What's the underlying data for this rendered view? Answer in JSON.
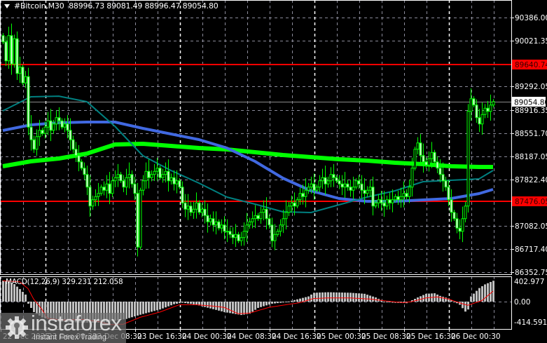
{
  "header": {
    "symbol": "#Bitcoin,M30",
    "ohlc": "88996.73 89081.49 88996.47 89054.80"
  },
  "colors": {
    "background": "#000000",
    "candle": "#00ff00",
    "bear_fill": "#d8ffd8",
    "ma_slow": "#00ff00",
    "ma_mid": "#4169e1",
    "ma_fast": "#008080",
    "level_line": "#ff0000",
    "macd_hist": "#c0c0c0",
    "macd_signal": "#ff0000",
    "grid": "#8a8a99"
  },
  "chart_data": [
    {
      "type": "candlestick",
      "title": "#Bitcoin,M30",
      "timeframe": "M30",
      "ylim": [
        86352.75,
        90386.0
      ],
      "y_ticks": [
        "90386.00",
        "90021.35",
        "89292.05",
        "88916.35",
        "88551.70",
        "88187.05",
        "87822.40",
        "87082.05",
        "86717.40",
        "86352.75"
      ],
      "x_ticks": [
        "22 Dec 2025",
        "23 Dec 00:30",
        "23 Dec 08:30",
        "23 Dec 16:30",
        "24 Dec 00:30",
        "24 Dec 08:30",
        "24 Dec 16:30",
        "25 Dec 00:30",
        "25 Dec 08:30",
        "25 Dec 16:30",
        "26 Dec 00:30"
      ],
      "bars_per_tick": 16,
      "grid": true,
      "current_price": "89054.80",
      "levels": [
        {
          "name": "resistance",
          "value": "89640.74"
        },
        {
          "name": "support",
          "value": "87476.05"
        }
      ],
      "closes": [
        90000,
        89700,
        90100,
        89650,
        90050,
        89500,
        89600,
        89350,
        89450,
        88650,
        88450,
        88300,
        88500,
        88600,
        88550,
        88650,
        88750,
        88600,
        88700,
        88800,
        88750,
        88650,
        88700,
        88600,
        88450,
        88300,
        88200,
        88100,
        88000,
        87900,
        87700,
        87400,
        87500,
        87550,
        87600,
        87700,
        87650,
        87750,
        87600,
        87800,
        87850,
        87900,
        87800,
        87700,
        87850,
        87900,
        87750,
        87600,
        86750,
        87650,
        87800,
        87950,
        87850,
        87900,
        87950,
        88000,
        87850,
        87900,
        87950,
        87800,
        87850,
        87750,
        87800,
        87700,
        87450,
        87350,
        87400,
        87300,
        87350,
        87450,
        87300,
        87350,
        87250,
        87150,
        87200,
        87100,
        87150,
        87050,
        87100,
        87000,
        87000,
        86950,
        86900,
        86950,
        86850,
        86900,
        87000,
        87100,
        87150,
        87200,
        87250,
        87200,
        87300,
        87350,
        87200,
        87100,
        86850,
        86950,
        87000,
        87100,
        87200,
        87300,
        87400,
        87450,
        87400,
        87500,
        87600,
        87550,
        87650,
        87700,
        87750,
        87650,
        87700,
        87800,
        87850,
        87750,
        87800,
        87900,
        87850,
        87800,
        87750,
        87700,
        87750,
        87700,
        87650,
        87700,
        87800,
        87750,
        87650,
        87600,
        87650,
        87700,
        87400,
        87450,
        87500,
        87450,
        87400,
        87500,
        87450,
        87500,
        87550,
        87500,
        87550,
        87600,
        87550,
        87700,
        88000,
        88300,
        88400,
        88200,
        88100,
        88050,
        88150,
        88250,
        88100,
        88000,
        87900,
        87800,
        87700,
        87500,
        87300,
        87200,
        87050,
        87000,
        87200,
        87400,
        88900,
        89100,
        89000,
        88800,
        88700,
        88850,
        88950,
        88900,
        89000,
        89054.8
      ],
      "moving_averages": [
        {
          "name": "MA slow",
          "color_key": "ma_slow",
          "points": [
            [
              0,
              88030
            ],
            [
              10,
              88108
            ],
            [
              20,
              88153
            ],
            [
              30,
              88230
            ],
            [
              40,
              88375
            ],
            [
              50,
              88386
            ],
            [
              60,
              88353
            ],
            [
              70,
              88319
            ],
            [
              80,
              88297
            ],
            [
              90,
              88253
            ],
            [
              100,
              88208
            ],
            [
              110,
              88175
            ],
            [
              120,
              88142
            ],
            [
              130,
              88119
            ],
            [
              140,
              88086
            ],
            [
              150,
              88064
            ],
            [
              160,
              88030
            ],
            [
              170,
              88019
            ],
            [
              175,
              88019
            ]
          ]
        },
        {
          "name": "MA mid",
          "color_key": "ma_mid",
          "points": [
            [
              0,
              88597
            ],
            [
              10,
              88686
            ],
            [
              20,
              88719
            ],
            [
              30,
              88730
            ],
            [
              40,
              88730
            ],
            [
              50,
              88630
            ],
            [
              60,
              88542
            ],
            [
              70,
              88453
            ],
            [
              80,
              88319
            ],
            [
              90,
              88108
            ],
            [
              100,
              87842
            ],
            [
              110,
              87642
            ],
            [
              120,
              87519
            ],
            [
              130,
              87475
            ],
            [
              140,
              87475
            ],
            [
              150,
              87497
            ],
            [
              160,
              87519
            ],
            [
              170,
              87597
            ],
            [
              175,
              87664
            ]
          ]
        },
        {
          "name": "MA fast",
          "color_key": "ma_fast",
          "points": [
            [
              0,
              88908
            ],
            [
              10,
              89130
            ],
            [
              20,
              89141
            ],
            [
              30,
              89053
            ],
            [
              40,
              88664
            ],
            [
              50,
              88197
            ],
            [
              60,
              87964
            ],
            [
              70,
              87764
            ],
            [
              80,
              87542
            ],
            [
              90,
              87430
            ],
            [
              100,
              87308
            ],
            [
              110,
              87297
            ],
            [
              120,
              87419
            ],
            [
              130,
              87542
            ],
            [
              140,
              87642
            ],
            [
              150,
              87786
            ],
            [
              160,
              87808
            ],
            [
              170,
              87830
            ],
            [
              175,
              87964
            ]
          ]
        }
      ]
    },
    {
      "type": "bar+line",
      "title": "MACD(12,26,9)",
      "macd_value": "329.231",
      "signal_value": "212.058",
      "ylim": [
        -414.591,
        402.977
      ],
      "y_ticks": [
        "402.977",
        "0.00",
        "-414.591"
      ],
      "histogram_points": [
        [
          0,
          400
        ],
        [
          2,
          380
        ],
        [
          4,
          335
        ],
        [
          6,
          240
        ],
        [
          8,
          135
        ],
        [
          9,
          -40
        ],
        [
          11,
          -200
        ],
        [
          14,
          -300
        ],
        [
          19,
          -380
        ],
        [
          29,
          -400
        ],
        [
          36,
          -400
        ],
        [
          44,
          -330
        ],
        [
          49,
          -250
        ],
        [
          56,
          -150
        ],
        [
          61,
          -50
        ],
        [
          64,
          -20
        ],
        [
          69,
          -60
        ],
        [
          79,
          -200
        ],
        [
          85,
          -255
        ],
        [
          88,
          -230
        ],
        [
          91,
          -120
        ],
        [
          96,
          -40
        ],
        [
          101,
          -10
        ],
        [
          104,
          30
        ],
        [
          109,
          100
        ],
        [
          111,
          170
        ],
        [
          116,
          180
        ],
        [
          124,
          170
        ],
        [
          129,
          150
        ],
        [
          133,
          80
        ],
        [
          136,
          0
        ],
        [
          139,
          -20
        ],
        [
          144,
          -30
        ],
        [
          145,
          0
        ],
        [
          148,
          80
        ],
        [
          151,
          150
        ],
        [
          154,
          160
        ],
        [
          156,
          110
        ],
        [
          159,
          60
        ],
        [
          161,
          0
        ],
        [
          163,
          -60
        ],
        [
          165,
          -190
        ],
        [
          166,
          -150
        ],
        [
          167,
          100
        ],
        [
          170,
          260
        ],
        [
          172,
          330
        ],
        [
          175,
          400
        ]
      ],
      "signal_points": [
        [
          0,
          400
        ],
        [
          6,
          380
        ],
        [
          9,
          250
        ],
        [
          11,
          50
        ],
        [
          14,
          -150
        ],
        [
          16,
          -320
        ],
        [
          21,
          -350
        ],
        [
          29,
          -340
        ],
        [
          34,
          -380
        ],
        [
          39,
          -440
        ],
        [
          43,
          -430
        ],
        [
          49,
          -300
        ],
        [
          56,
          -200
        ],
        [
          63,
          -60
        ],
        [
          69,
          -60
        ],
        [
          74,
          -80
        ],
        [
          79,
          -110
        ],
        [
          84,
          -230
        ],
        [
          88,
          -220
        ],
        [
          95,
          -110
        ],
        [
          101,
          -60
        ],
        [
          106,
          -20
        ],
        [
          111,
          60
        ],
        [
          116,
          70
        ],
        [
          124,
          70
        ],
        [
          131,
          50
        ],
        [
          139,
          0
        ],
        [
          143,
          -20
        ],
        [
          146,
          0
        ],
        [
          151,
          70
        ],
        [
          155,
          90
        ],
        [
          159,
          50
        ],
        [
          164,
          -40
        ],
        [
          166,
          -70
        ],
        [
          171,
          20
        ],
        [
          175,
          200
        ]
      ]
    }
  ],
  "watermark": {
    "name": "instaforex",
    "tagline": "Instant Forex Trading"
  }
}
